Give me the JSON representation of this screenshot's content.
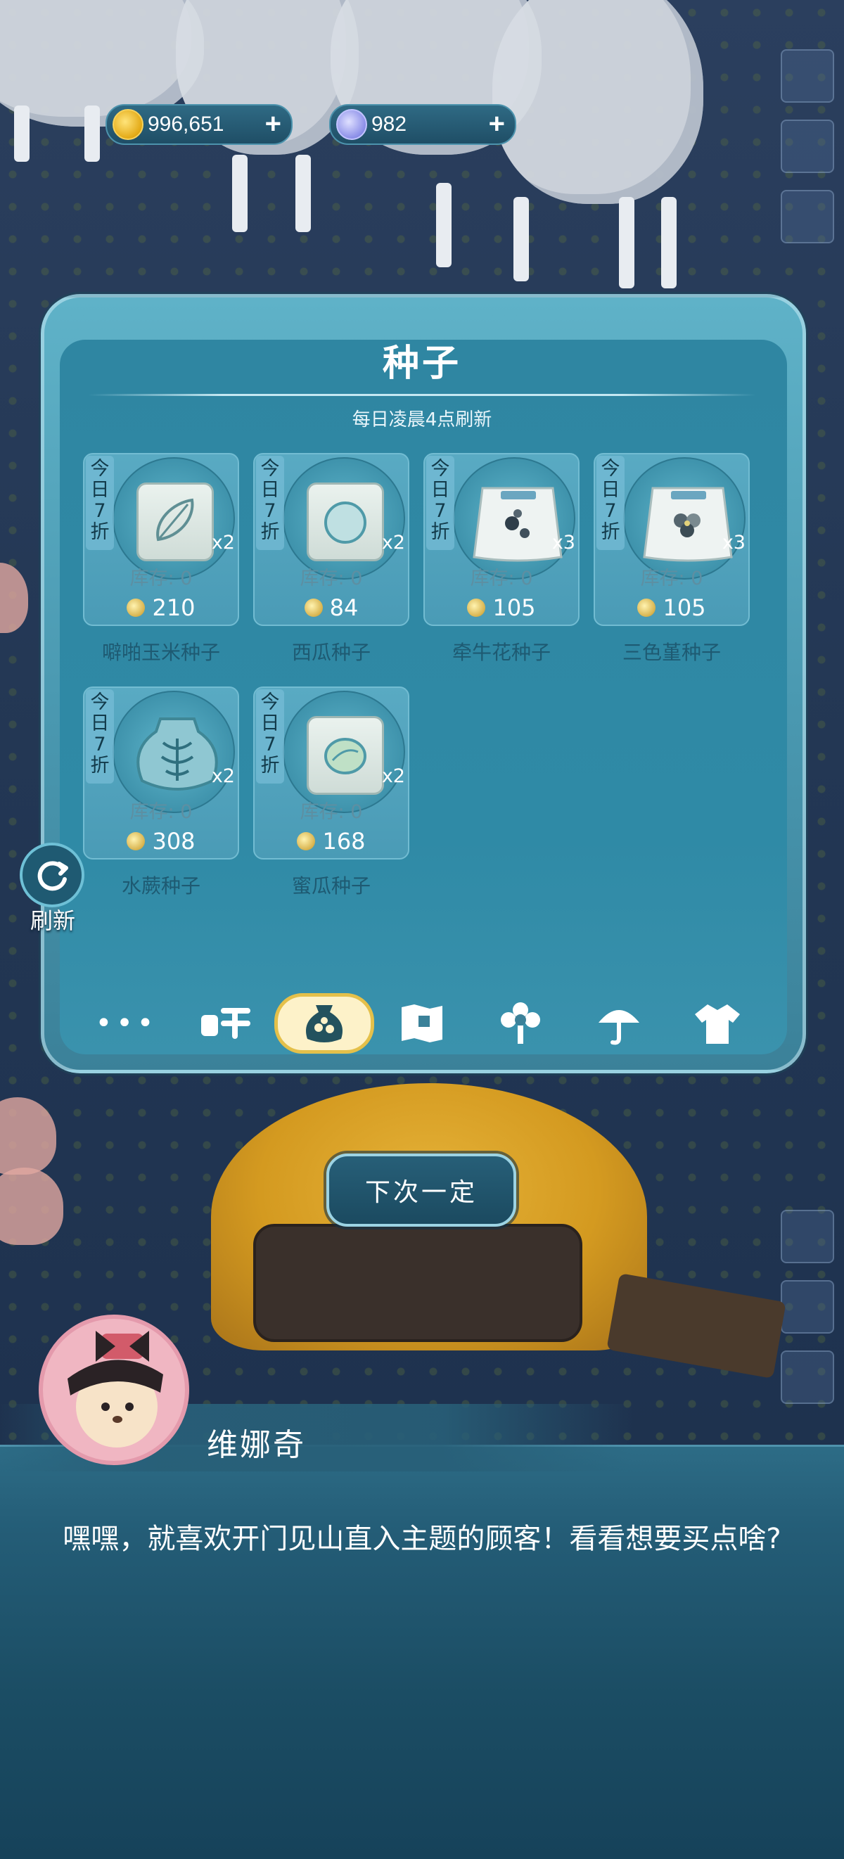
{
  "currency": {
    "coins": "996,651",
    "moons": "982",
    "add_glyph": "+"
  },
  "shop": {
    "title": "种子",
    "subtitle": "每日凌晨4点刷新",
    "items": [
      {
        "sale": "今日7折",
        "sale_chars": [
          "今",
          "日",
          "7",
          "折"
        ],
        "qty": "x2",
        "stock": "库存: 0",
        "price": "210",
        "name": "噼啪玉米种子",
        "icon": "corn-seed-pack-icon"
      },
      {
        "sale": "今日7折",
        "sale_chars": [
          "今",
          "日",
          "7",
          "折"
        ],
        "qty": "x2",
        "stock": "库存: 0",
        "price": "84",
        "name": "西瓜种子",
        "icon": "watermelon-seed-pack-icon"
      },
      {
        "sale": "今日7折",
        "sale_chars": [
          "今",
          "日",
          "7",
          "折"
        ],
        "qty": "x3",
        "stock": "库存: 0",
        "price": "105",
        "name": "牵牛花种子",
        "icon": "morning-glory-seed-bag-icon"
      },
      {
        "sale": "今日7折",
        "sale_chars": [
          "今",
          "日",
          "7",
          "折"
        ],
        "qty": "x3",
        "stock": "库存: 0",
        "price": "105",
        "name": "三色堇种子",
        "icon": "pansy-seed-bag-icon"
      },
      {
        "sale": "今日7折",
        "sale_chars": [
          "今",
          "日",
          "7",
          "折"
        ],
        "qty": "x2",
        "stock": "库存: 0",
        "price": "308",
        "name": "水蕨种子",
        "icon": "water-fern-seed-sack-icon"
      },
      {
        "sale": "今日7折",
        "sale_chars": [
          "今",
          "日",
          "7",
          "折"
        ],
        "qty": "x2",
        "stock": "库存: 0",
        "price": "168",
        "name": "蜜瓜种子",
        "icon": "melon-seed-pack-icon"
      }
    ],
    "tabs": [
      {
        "icon": "more-dots-icon"
      },
      {
        "icon": "food-icon"
      },
      {
        "icon": "seed-bag-icon",
        "active": true
      },
      {
        "icon": "map-icon"
      },
      {
        "icon": "flower-icon"
      },
      {
        "icon": "umbrella-icon"
      },
      {
        "icon": "clothing-icon"
      }
    ]
  },
  "refresh": {
    "label": "刷新"
  },
  "decline_button": {
    "label": "下次一定"
  },
  "dialogue": {
    "speaker": "维娜奇",
    "text": "嘿嘿，就喜欢开门见山直入主题的顾客！看看想要买点啥?"
  }
}
